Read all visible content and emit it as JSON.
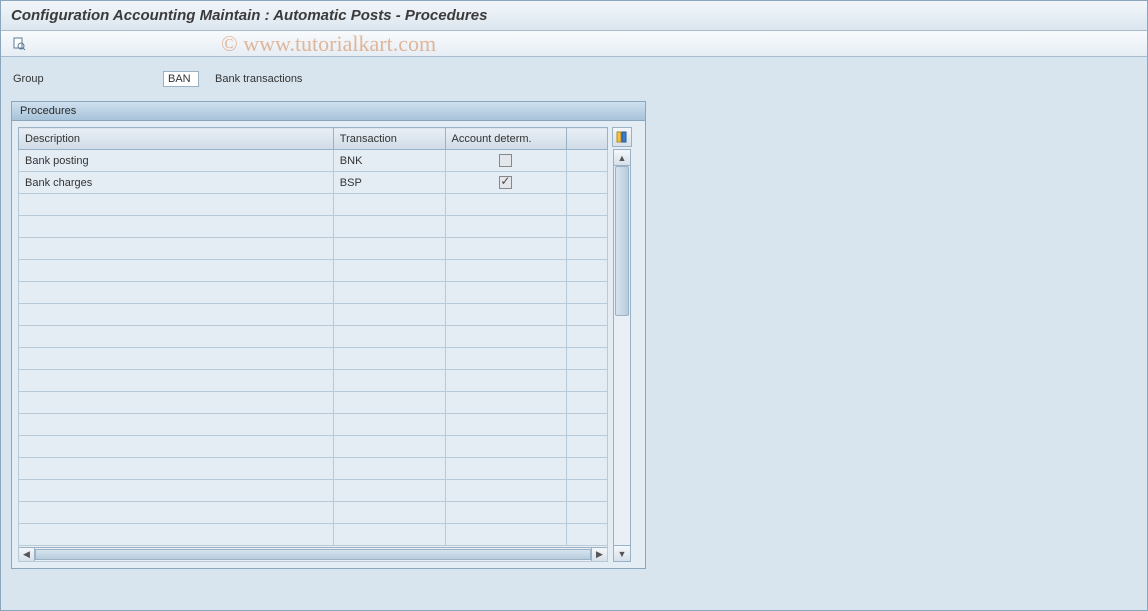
{
  "header": {
    "title": "Configuration Accounting Maintain : Automatic Posts - Procedures"
  },
  "group": {
    "label": "Group",
    "value": "BAN",
    "description": "Bank transactions"
  },
  "panel": {
    "title": "Procedures"
  },
  "table": {
    "columns": {
      "description": "Description",
      "transaction": "Transaction",
      "account_determ": "Account determ."
    },
    "rows": [
      {
        "description": "Bank posting",
        "transaction": "BNK",
        "account_determ": false,
        "link": true
      },
      {
        "description": "Bank charges",
        "transaction": "BSP",
        "account_determ": true,
        "link": false
      }
    ],
    "empty_row_count": 16
  },
  "watermark": "© www.tutorialkart.com"
}
